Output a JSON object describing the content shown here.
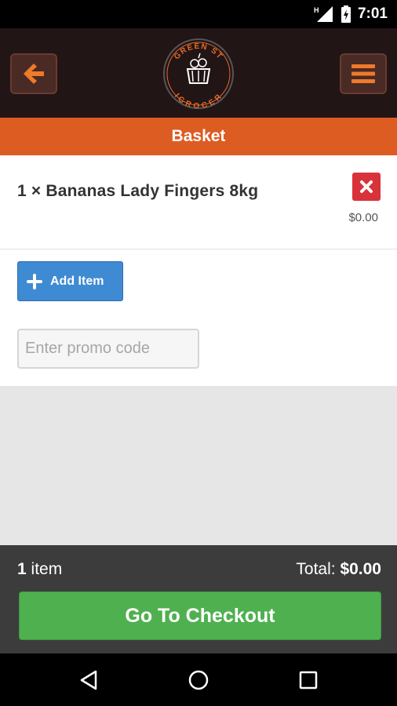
{
  "status_bar": {
    "time": "7:01",
    "icons": [
      "signal-icon",
      "battery-charging-icon"
    ]
  },
  "header": {
    "back_icon": "arrow-left-icon",
    "menu_icon": "hamburger-menu-icon",
    "logo": {
      "top_text": "GREEN ST",
      "bottom_text": "IGROCER",
      "icon": "basket-icon"
    }
  },
  "page_title": "Basket",
  "basket": {
    "items": [
      {
        "label": "1 × Bananas Lady Fingers 8kg",
        "price": "$0.00"
      }
    ]
  },
  "add_item_label": "Add Item",
  "promo": {
    "placeholder": "Enter promo code",
    "value": ""
  },
  "footer": {
    "count": "1",
    "count_label": " item",
    "total_label": "Total: ",
    "total_value": "$0.00",
    "checkout_label": "Go To Checkout"
  },
  "colors": {
    "accent": "#dd5c22",
    "header_bg": "#221516",
    "checkout_green": "#4fb04f",
    "add_blue": "#3f8bd3",
    "remove_red": "#d8323a"
  },
  "nav": [
    "back-triangle-icon",
    "home-circle-icon",
    "recents-square-icon"
  ]
}
